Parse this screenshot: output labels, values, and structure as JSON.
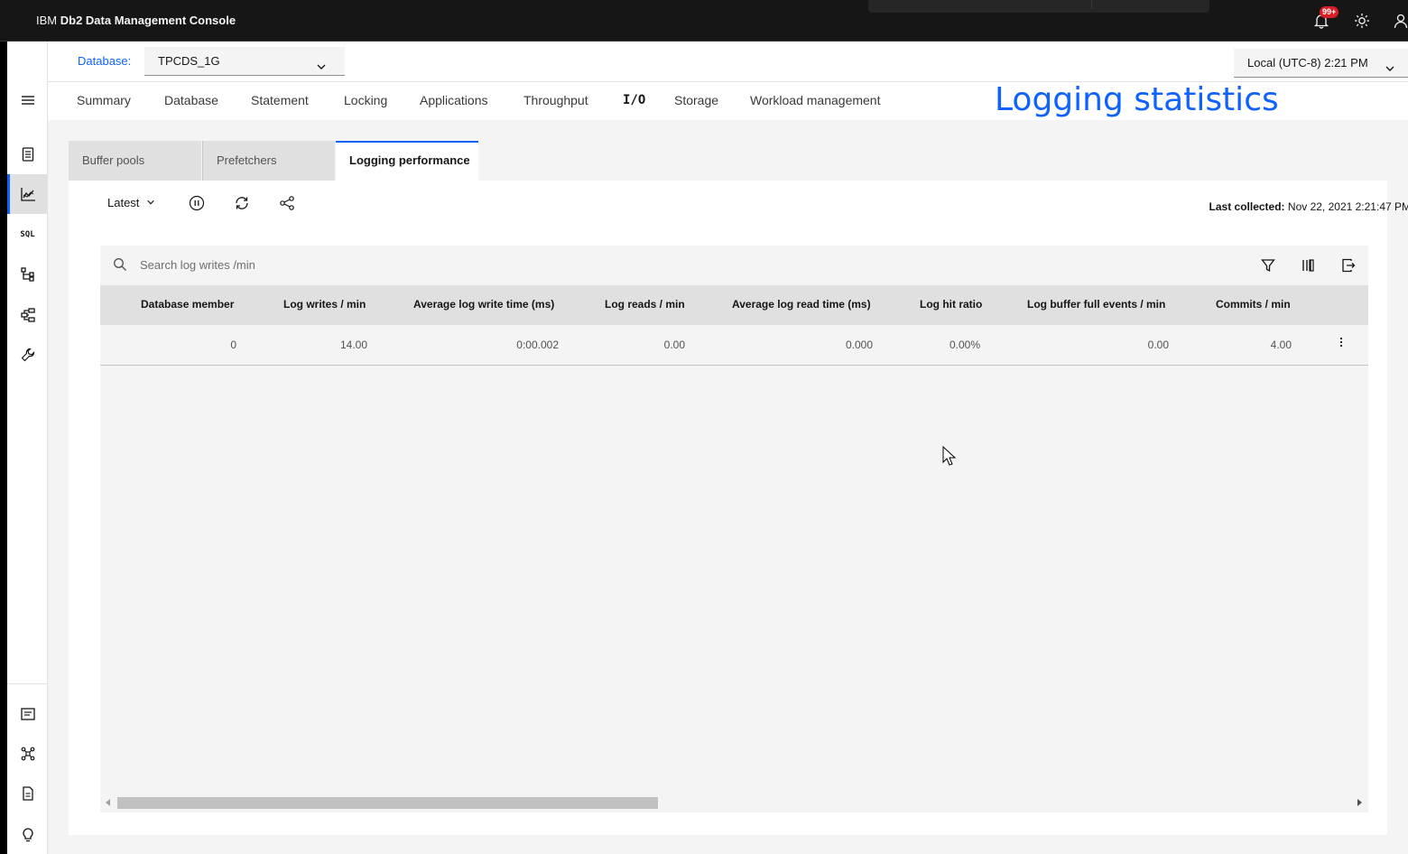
{
  "header": {
    "brand_prefix": "IBM",
    "brand_name": "Db2 Data Management Console",
    "notification_badge": "99+"
  },
  "db_bar": {
    "database_label": "Database:",
    "database_value": "TPCDS_1G",
    "timezone_value": "Local (UTC-8) 2:21 PM"
  },
  "nav_tabs": [
    {
      "label": "Summary"
    },
    {
      "label": "Database"
    },
    {
      "label": "Statement"
    },
    {
      "label": "Locking"
    },
    {
      "label": "Applications"
    },
    {
      "label": "Throughput"
    },
    {
      "label": "I/O"
    },
    {
      "label": "Storage"
    },
    {
      "label": "Workload management"
    }
  ],
  "overlay_title": "Logging statistics",
  "sidebar": {
    "sql_label": "SQL"
  },
  "sub_tabs": [
    {
      "label": "Buffer pools"
    },
    {
      "label": "Prefetchers"
    },
    {
      "label": "Logging performance"
    }
  ],
  "toolbar": {
    "latest_label": "Latest",
    "last_collected_label": "Last collected:",
    "last_collected_value": "Nov 22, 2021 2:21:47 PM"
  },
  "table": {
    "search_placeholder": "Search log writes /min",
    "columns": [
      "Database member",
      "Log writes / min",
      "Average log write time (ms)",
      "Log reads / min",
      "Average log read time (ms)",
      "Log hit ratio",
      "Log buffer full events / min",
      "Commits / min"
    ],
    "rows": [
      [
        "0",
        "14.00",
        "0:00.002",
        "0.00",
        "0.000",
        "0.00%",
        "0.00",
        "4.00"
      ]
    ]
  },
  "colors": {
    "accent": "#0f62fe",
    "header_bg": "#161616",
    "badge": "#da1e28"
  }
}
